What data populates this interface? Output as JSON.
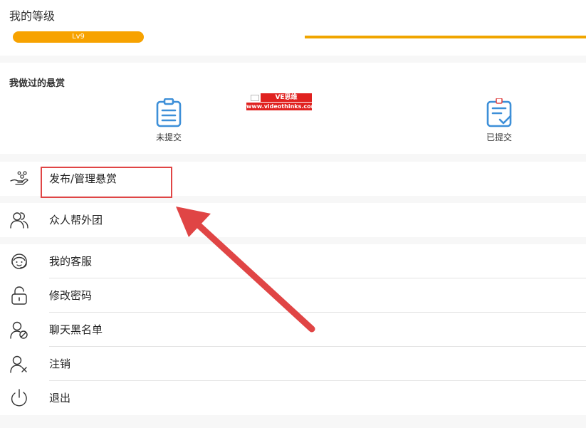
{
  "level": {
    "title": "我的等级",
    "badge": "Lv9"
  },
  "bounties": {
    "title": "我做过的悬赏",
    "items": [
      {
        "label": "未提交",
        "icon": "clipboard-list-icon"
      },
      {
        "label": "已提交",
        "icon": "clipboard-check-icon"
      }
    ]
  },
  "watermark": {
    "brand": "VE思维",
    "url": "www.videothinks.com"
  },
  "menu": {
    "publish": {
      "label": "发布/管理悬赏",
      "icon": "hand-coins-icon"
    },
    "team": {
      "label": "众人帮外团",
      "icon": "users-icon"
    },
    "service": {
      "label": "我的客服",
      "icon": "customer-service-icon"
    },
    "password": {
      "label": "修改密码",
      "icon": "lock-icon"
    },
    "blacklist": {
      "label": "聊天黑名单",
      "icon": "user-block-icon"
    },
    "cancel": {
      "label": "注销",
      "icon": "user-remove-icon"
    },
    "logout": {
      "label": "退出",
      "icon": "power-icon"
    }
  },
  "colors": {
    "accent": "#f7a200",
    "icon_blue": "#3d8fd8",
    "annotation_red": "#e04545"
  }
}
